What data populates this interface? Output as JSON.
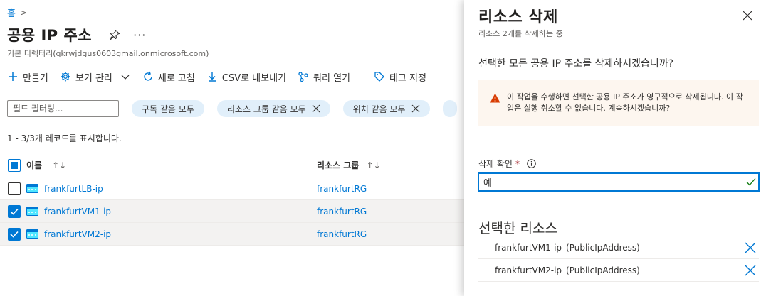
{
  "breadcrumb": {
    "home": "홈",
    "separator": ">"
  },
  "page": {
    "title": "공용 IP 주소",
    "more": "···",
    "subtitle": "기본 디렉터리(qkrwjdgus0603gmail.onmicrosoft.com)"
  },
  "toolbar": {
    "create": "만들기",
    "manage_view": "보기 관리",
    "refresh": "새로 고침",
    "export_csv": "CSV로 내보내기",
    "open_query": "쿼리 열기",
    "assign_tags": "태그 지정"
  },
  "filters": {
    "placeholder": "필드 필터링...",
    "pills": [
      {
        "label": "구독 같음 모두",
        "removable": false
      },
      {
        "label": "리소스 그룹 같음 모두",
        "removable": true
      },
      {
        "label": "위치 같음 모두",
        "removable": true
      }
    ]
  },
  "record_count": "1 - 3/3개 레코드를 표시합니다.",
  "grid": {
    "columns": {
      "name": "이름",
      "resource_group": "리소스 그룹",
      "sort_name": "↑↓",
      "sort_rg": "↑↓"
    },
    "rows": [
      {
        "name": "frankfurtLB-ip",
        "resource_group": "frankfurtRG",
        "selected": false
      },
      {
        "name": "frankfurtVM1-ip",
        "resource_group": "frankfurtRG",
        "selected": true
      },
      {
        "name": "frankfurtVM2-ip",
        "resource_group": "frankfurtRG",
        "selected": true
      }
    ]
  },
  "panel": {
    "title": "리소스 삭제",
    "subtitle": "리소스 2개를 삭제하는 중",
    "question": "선택한 모든 공용 IP 주소를 삭제하시겠습니까?",
    "warning": "이 작업을 수행하면 선택한 공용 IP 주소가 영구적으로 삭제됩니다. 이 작업은 실행 취소할 수 없습니다. 계속하시겠습니까?",
    "confirm_label": "삭제 확인",
    "required_mark": "*",
    "confirm_value": "예",
    "selected_title": "선택한 리소스",
    "selected": [
      {
        "name": "frankfurtVM1-ip",
        "type": "(PublicIpAddress)"
      },
      {
        "name": "frankfurtVM2-ip",
        "type": "(PublicIpAddress)"
      }
    ]
  },
  "colors": {
    "accent": "#0078d4",
    "pill_bg": "#e1effa",
    "warning_bg": "#fdf6ef",
    "warning_icon": "#d83b01",
    "success": "#107c10"
  }
}
